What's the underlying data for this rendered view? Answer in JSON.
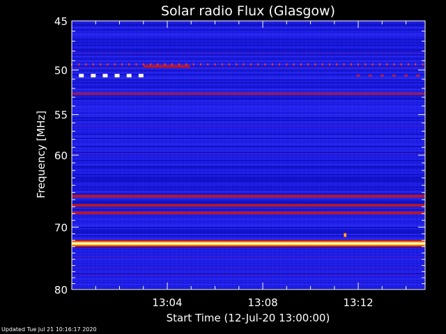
{
  "chart_data": {
    "type": "heatmap",
    "title": "Solar radio Flux (Glasgow)",
    "xlabel": "Start Time (12-Jul-20 13:00:00)",
    "ylabel": "Frequency [MHz]",
    "x_ticks": [
      "13:04",
      "13:08",
      "13:12"
    ],
    "x_tick_minutes": [
      4,
      8,
      12
    ],
    "y_ticks": [
      45,
      50,
      55,
      60,
      70,
      80
    ],
    "x_range_minutes": [
      0,
      14.8
    ],
    "y_range_mhz": [
      45,
      80
    ],
    "y_scale": "log",
    "background_color": "#1a1ae0",
    "features": [
      {
        "kind": "line",
        "freq": 72.5,
        "t0": 0,
        "t1": 14.8,
        "level": "high"
      },
      {
        "kind": "line",
        "freq": 65.5,
        "t0": 0,
        "t1": 14.8,
        "level": "mid"
      },
      {
        "kind": "line",
        "freq": 66.8,
        "t0": 0,
        "t1": 14.8,
        "level": "mid"
      },
      {
        "kind": "line",
        "freq": 67.9,
        "t0": 0,
        "t1": 14.8,
        "level": "mid"
      },
      {
        "kind": "line",
        "freq": 52.6,
        "t0": 0,
        "t1": 14.8,
        "level": "low"
      },
      {
        "kind": "line",
        "freq": 49.6,
        "t0": 3.0,
        "t1": 4.95,
        "level": "mid"
      },
      {
        "kind": "dots",
        "freq": 49.4,
        "t0": 0,
        "t1": 14.8,
        "step": 0.3,
        "level": "mid"
      },
      {
        "kind": "dashes",
        "freq": 50.6,
        "t0": 0.4,
        "t1": 3.1,
        "step": 0.5,
        "level": "peak"
      },
      {
        "kind": "dashes",
        "freq": 50.6,
        "t0": 12.0,
        "t1": 14.8,
        "step": 0.5,
        "level": "low"
      },
      {
        "kind": "dot",
        "freq": 71.2,
        "t": 11.45,
        "level": "high"
      }
    ]
  },
  "footer": {
    "updated": "Updated Tue Jul 21 10:16:17 2020"
  }
}
